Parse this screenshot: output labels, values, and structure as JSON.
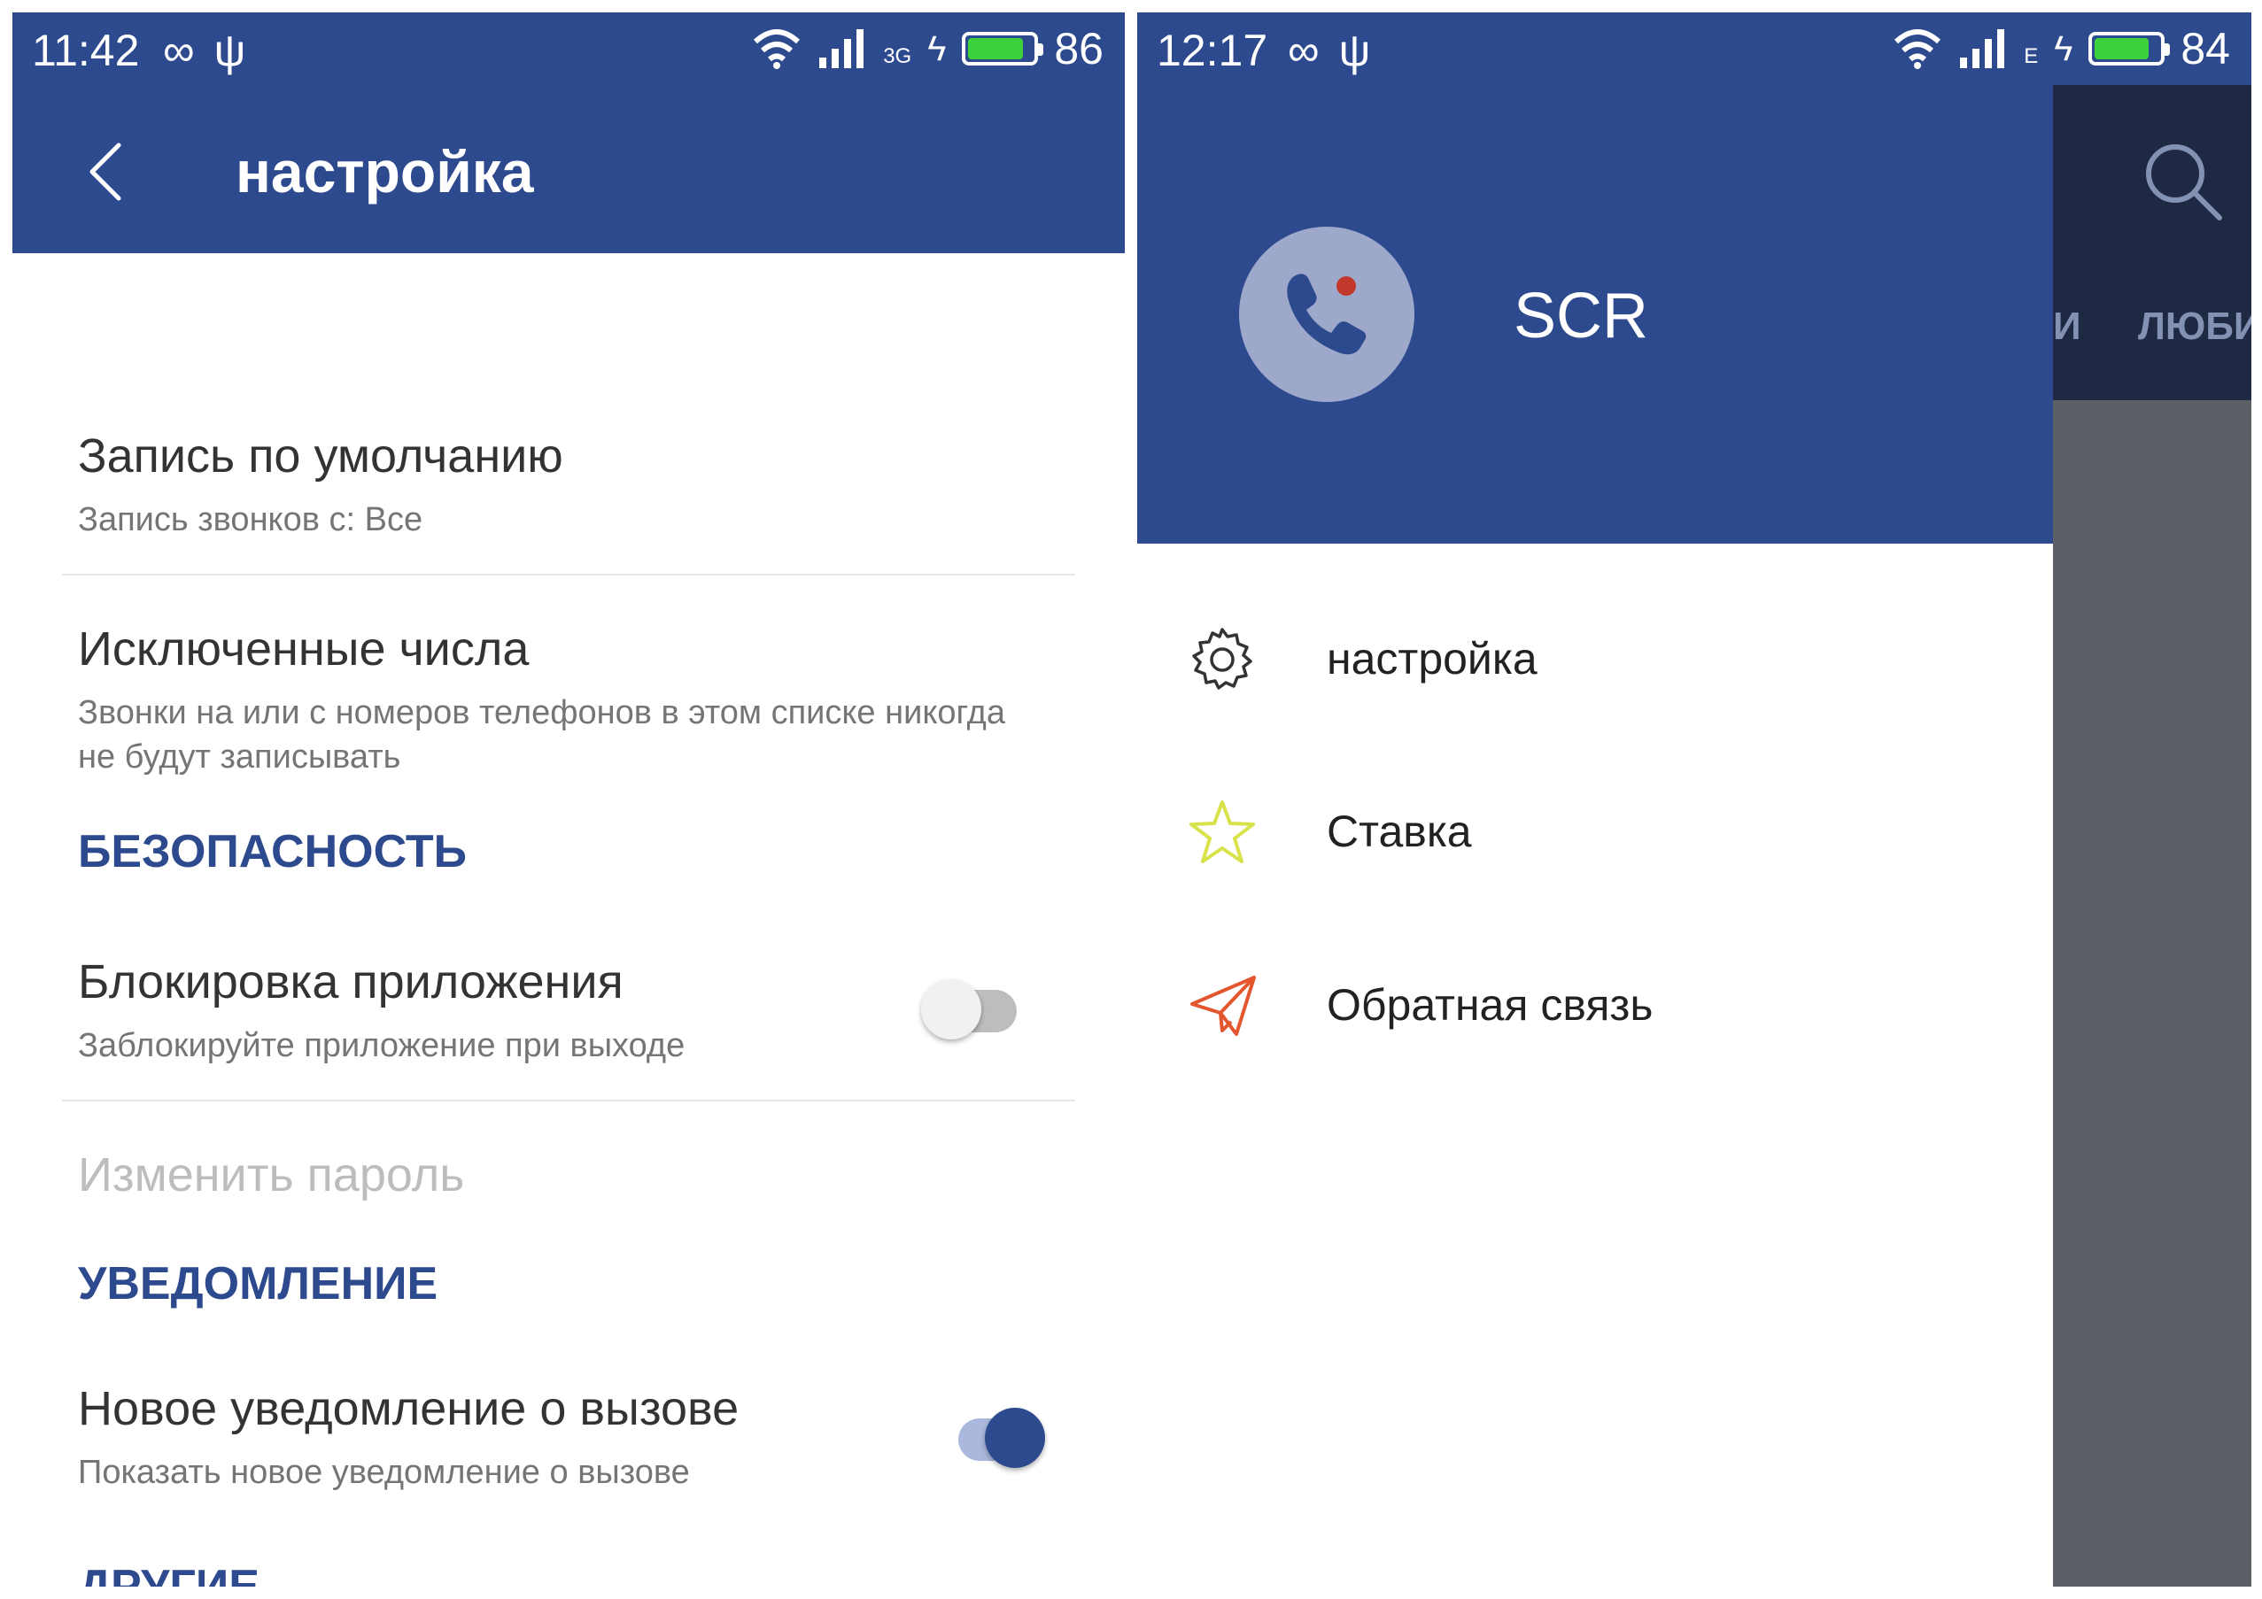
{
  "left_screen": {
    "status_bar": {
      "time": "11:42",
      "network": "3G",
      "battery": "86",
      "battery_level": 0.86
    },
    "app_bar": {
      "title": "настройка"
    },
    "prefs": {
      "default_record": {
        "title": "Запись по умолчанию",
        "summary": "Запись звонков с: Все"
      },
      "excluded_numbers": {
        "title": "Исключенные числа",
        "summary": "Звонки на или с номеров телефонов в этом списке никогда не будут записывать"
      },
      "security_header": "БЕЗОПАСНОСТЬ",
      "app_lock": {
        "title": "Блокировка приложения",
        "summary": "Заблокируйте приложение при выходе",
        "enabled": false
      },
      "change_password": {
        "title": "Изменить пароль"
      },
      "notification_header": "УВЕДОМЛЕНИЕ",
      "new_call_notification": {
        "title": "Новое уведомление о вызове",
        "summary": "Показать новое уведомление о вызове",
        "enabled": true
      },
      "others_header": "ДРУГИЕ"
    }
  },
  "right_screen": {
    "status_bar": {
      "time": "12:17",
      "network": "E",
      "battery": "84",
      "battery_level": 0.84
    },
    "drawer": {
      "app_name": "SCR",
      "items": [
        {
          "label": "настройка",
          "icon": "gear-icon"
        },
        {
          "label": "Ставка",
          "icon": "star-icon"
        },
        {
          "label": "Обратная связь",
          "icon": "send-icon"
        }
      ]
    },
    "background": {
      "tab_partial_1": "И",
      "tab_partial_2": "ЛЮБИ"
    }
  },
  "colors": {
    "primary": "#2e4a8e",
    "battery": "#3ed13e",
    "star": "#d8e24a",
    "send": "#e4572e",
    "record_dot": "#c0392b"
  }
}
